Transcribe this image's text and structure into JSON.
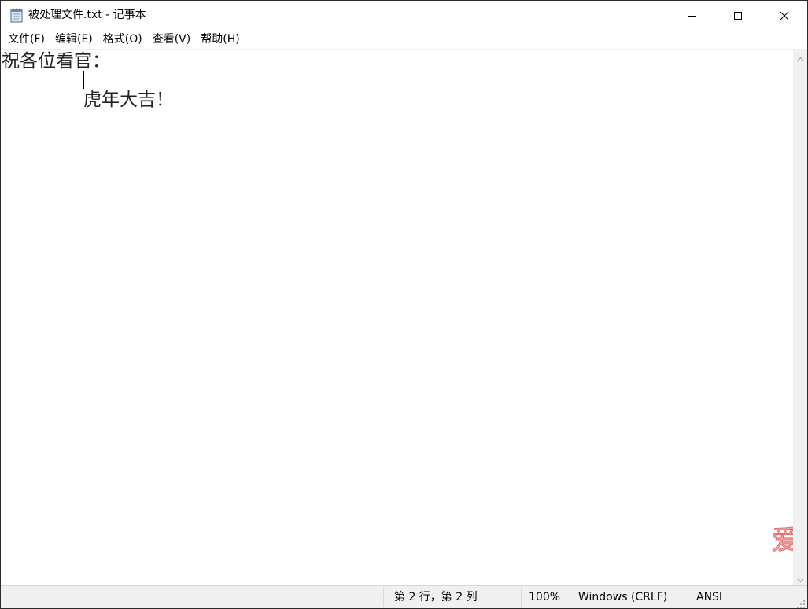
{
  "window": {
    "title": "被处理文件.txt - 记事本",
    "app_icon": "notepad-icon"
  },
  "caption_buttons": {
    "minimize_icon": "minimize-icon",
    "maximize_icon": "maximize-icon",
    "close_icon": "close-icon"
  },
  "menubar": {
    "items": [
      {
        "label": "文件(F)"
      },
      {
        "label": "编辑(E)"
      },
      {
        "label": "格式(O)"
      },
      {
        "label": "查看(V)"
      },
      {
        "label": "帮助(H)"
      }
    ]
  },
  "editor": {
    "lines": [
      "祝各位看官：",
      "虎年大吉！"
    ]
  },
  "watermark": {
    "text": "爱"
  },
  "statusbar": {
    "position": "第 2 行，第 2 列",
    "zoom": "100%",
    "line_ending": "Windows (CRLF)",
    "encoding": "ANSI"
  },
  "colors": {
    "watermark": "#e06d6d",
    "statusbar_bg": "#f0f0f0",
    "scrollbar_bg": "#f0f0f0"
  }
}
